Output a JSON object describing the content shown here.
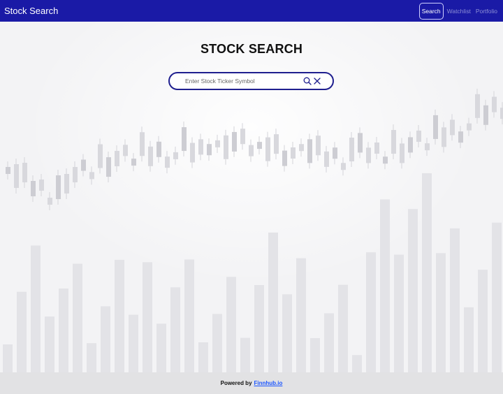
{
  "navbar": {
    "brand": "Stock Search",
    "links": [
      {
        "label": "Search",
        "active": true
      },
      {
        "label": "Watchlist",
        "active": false
      },
      {
        "label": "Portfolio",
        "active": false
      }
    ]
  },
  "main": {
    "title": "STOCK SEARCH",
    "search": {
      "placeholder": "Enter Stock Ticker Symbol",
      "value": ""
    }
  },
  "footer": {
    "prefix": "Powered by",
    "link_text": "Finnhub.io"
  },
  "colors": {
    "navbar": "#1a1aa6",
    "accent": "#1f1f8f",
    "link": "#1a55ff"
  }
}
